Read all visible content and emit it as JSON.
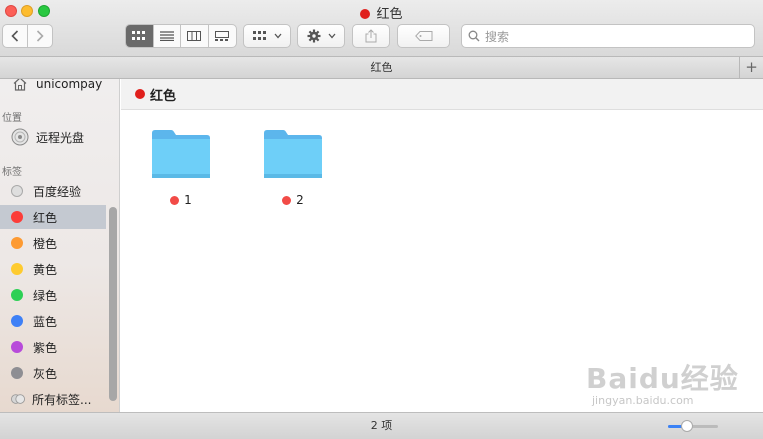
{
  "window": {
    "title": "红色",
    "title_dot_color": "#e0201d"
  },
  "toolbar": {
    "back_icon": "chevron-left-icon",
    "forward_icon": "chevron-right-icon",
    "view_modes": [
      "icon-view-icon",
      "list-view-icon",
      "column-view-icon",
      "gallery-view-icon"
    ],
    "active_view": "icon-view-icon",
    "arrange_icon": "grid-arrange-icon",
    "action_icon": "gear-icon",
    "share_icon": "share-icon",
    "tag_icon": "tag-icon",
    "search_placeholder": "搜索"
  },
  "pathbar": {
    "title": "红色",
    "add_label": "+"
  },
  "sidebar": {
    "top_item": "unicompay",
    "section_locations": "位置",
    "remote_disc": "远程光盘",
    "section_tags": "标签",
    "tags": [
      {
        "label": "百度经验",
        "color": "#d0d0d0"
      },
      {
        "label": "红色",
        "color": "#fc3d39",
        "selected": true
      },
      {
        "label": "橙色",
        "color": "#fd9a32"
      },
      {
        "label": "黄色",
        "color": "#fecb2f"
      },
      {
        "label": "绿色",
        "color": "#2dd055"
      },
      {
        "label": "蓝色",
        "color": "#3e80f6"
      },
      {
        "label": "紫色",
        "color": "#b84bda"
      },
      {
        "label": "灰色",
        "color": "#8e8e93"
      }
    ],
    "all_tags": "所有标签..."
  },
  "content": {
    "header": "红色",
    "header_dot_color": "#e0201d",
    "folders": [
      {
        "name": "1",
        "tag_color": "#f24b47"
      },
      {
        "name": "2",
        "tag_color": "#f24b47"
      }
    ]
  },
  "statusbar": {
    "count": "2 项",
    "icon_size_fraction": 0.25
  },
  "watermark": {
    "logo": "Baidu经验",
    "url": "jingyan.baidu.com"
  }
}
